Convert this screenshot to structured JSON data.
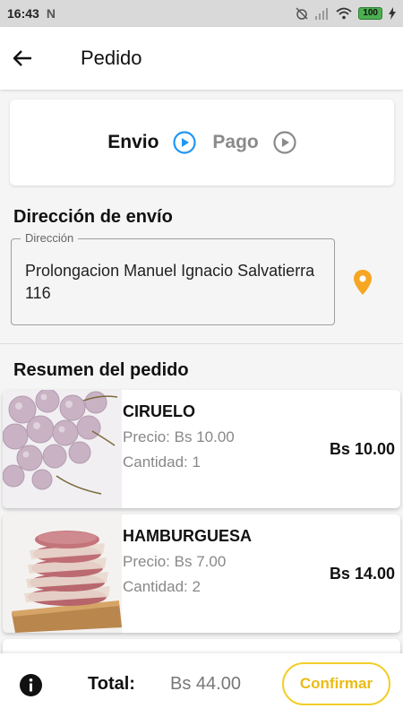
{
  "status_bar": {
    "time": "16:43",
    "battery": "100"
  },
  "app_bar": {
    "title": "Pedido"
  },
  "stepper": {
    "steps": [
      {
        "label": "Envio"
      },
      {
        "label": "Pago"
      }
    ]
  },
  "shipping": {
    "section_title": "Dirección de envío",
    "field_label": "Dirección",
    "address": "Prolongacion Manuel Ignacio Salvatierra 116"
  },
  "summary": {
    "section_title": "Resumen del pedido",
    "items": [
      {
        "name": "CIRUELO",
        "price": "Precio: Bs 10.00",
        "quantity": "Cantidad: 1",
        "subtotal": "Bs 10.00"
      },
      {
        "name": "HAMBURGUESA",
        "price": "Precio: Bs 7.00",
        "quantity": "Cantidad: 2",
        "subtotal": "Bs 14.00"
      }
    ]
  },
  "footer": {
    "total_label": "Total:",
    "total_value": "Bs 44.00",
    "confirm_label": "Confirmar"
  },
  "colors": {
    "accent_yellow": "#f2cf2a",
    "step_active_blue": "#2196f3",
    "pin_orange": "#f6a623"
  }
}
